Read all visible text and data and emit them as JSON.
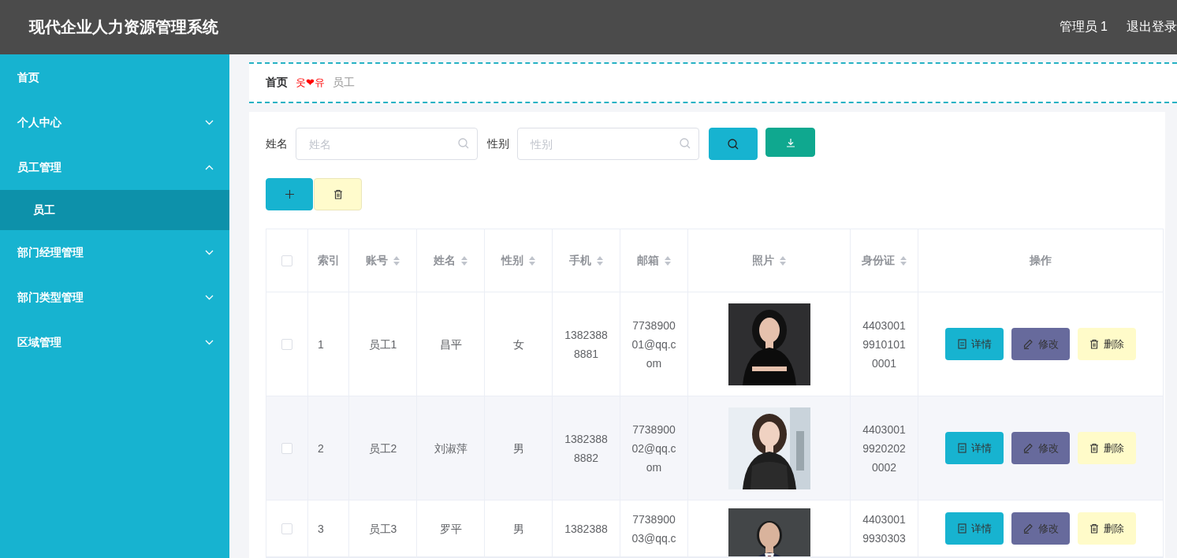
{
  "header": {
    "title": "现代企业人力资源管理系统",
    "user": "管理员 1",
    "logout": "退出登录"
  },
  "sidebar": {
    "items": [
      {
        "kind": "link",
        "label": "首页",
        "selected": false
      },
      {
        "kind": "submenu",
        "label": "个人中心",
        "selected": false,
        "expanded": false
      },
      {
        "kind": "submenu",
        "label": "员工管理",
        "selected": false,
        "expanded": true,
        "children": [
          {
            "label": "员工",
            "selected": true
          }
        ]
      },
      {
        "kind": "submenu",
        "label": "部门经理管理",
        "selected": false,
        "expanded": false
      },
      {
        "kind": "submenu",
        "label": "部门类型管理",
        "selected": false,
        "expanded": false
      },
      {
        "kind": "submenu",
        "label": "区域管理",
        "selected": false,
        "expanded": false
      }
    ]
  },
  "breadcrumb": {
    "separator": "웃❤유",
    "items": [
      {
        "label": "首页",
        "current": false
      },
      {
        "label": "员工",
        "current": true
      }
    ]
  },
  "search": {
    "fields": [
      {
        "label": "姓名",
        "placeholder": "姓名"
      },
      {
        "label": "性别",
        "placeholder": "性别"
      }
    ]
  },
  "table": {
    "header_checked": false,
    "columns": [
      {
        "label": "索引",
        "sortable": false
      },
      {
        "label": "账号",
        "sortable": true
      },
      {
        "label": "姓名",
        "sortable": true
      },
      {
        "label": "性别",
        "sortable": true
      },
      {
        "label": "手机",
        "sortable": true
      },
      {
        "label": "邮箱",
        "sortable": true
      },
      {
        "label": "照片",
        "sortable": true
      },
      {
        "label": "身份证",
        "sortable": true
      },
      {
        "label": "操作",
        "sortable": false
      }
    ],
    "rows": [
      {
        "checked": false,
        "cells": [
          "1",
          "员工1",
          "昌平",
          "女",
          "13823888881",
          "773890001@qq.com"
        ],
        "id_card": "440300199101010001",
        "actions": [
          {
            "kind": "detail",
            "label": "详情"
          },
          {
            "kind": "edit",
            "label": "修改"
          },
          {
            "kind": "delete",
            "label": "删除"
          }
        ]
      },
      {
        "checked": false,
        "cells": [
          "2",
          "员工2",
          "刘淑萍",
          "男",
          "13823888882",
          "773890002@qq.com"
        ],
        "id_card": "440300199202020002",
        "actions": [
          {
            "kind": "detail",
            "label": "详情"
          },
          {
            "kind": "edit",
            "label": "修改"
          },
          {
            "kind": "delete",
            "label": "删除"
          }
        ]
      },
      {
        "checked": false,
        "cells": [
          "3",
          "员工3",
          "罗平",
          "男",
          "1382388",
          "773890003@qq.c"
        ],
        "id_card": "44030019930303",
        "actions": [
          {
            "kind": "detail",
            "label": "详情"
          },
          {
            "kind": "edit",
            "label": "修改"
          },
          {
            "kind": "delete",
            "label": "删除"
          }
        ]
      }
    ]
  }
}
